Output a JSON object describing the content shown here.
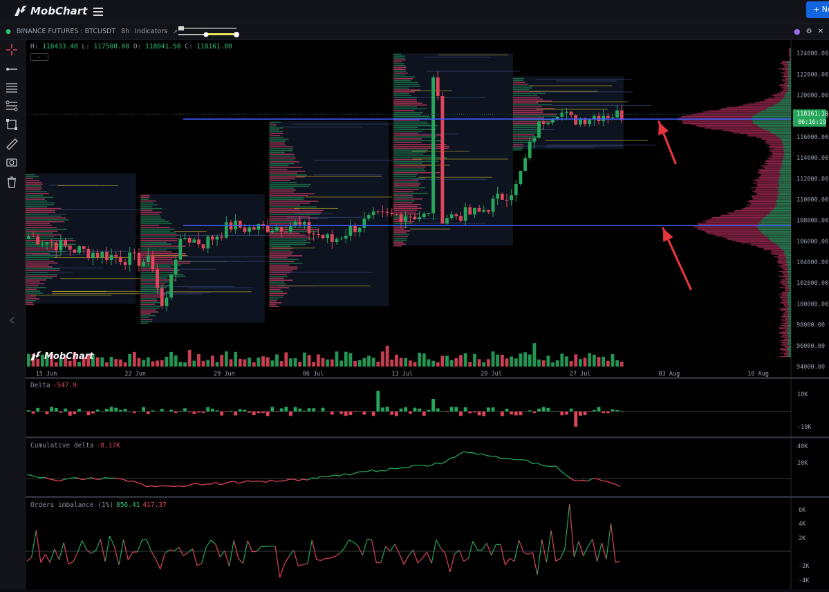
{
  "app": {
    "logo_text": "MobChart",
    "new_button_label": "+ Ne"
  },
  "symbol_bar": {
    "exchange_symbol": "BINANCE FUTURES : BTCUSDT",
    "timeframe": "8h",
    "indicators_label": "Indicators"
  },
  "ohlc": {
    "h_label": "H:",
    "h": "118433.40",
    "l_label": "L:",
    "l": "117500.00",
    "o_label": "O:",
    "o": "118041.50",
    "c_label": "C:",
    "c": "118161.00"
  },
  "watermark": "MobChart",
  "price_axis": {
    "labels": [
      "124000.00",
      "122000.00",
      "120000.00",
      "118000.00",
      "116000.00",
      "114000.00",
      "112000.00",
      "110000.00",
      "108000.00",
      "106000.00",
      "104000.00",
      "102000.00",
      "100000.00",
      "98000.00",
      "96000.00",
      "94000.00"
    ],
    "current_price": "118161.10",
    "countdown": "06:16:19"
  },
  "time_axis": {
    "labels": [
      "15 Jun",
      "22 Jun",
      "29 Jun",
      "06 Jul",
      "13 Jul",
      "20 Jul",
      "27 Jul",
      "03 Aug",
      "10 Aug"
    ]
  },
  "panels": {
    "delta": {
      "label": "Delta",
      "value": "-547.9",
      "axis": [
        "10K",
        "-10K"
      ]
    },
    "cumulative_delta": {
      "label": "Cumulative delta",
      "value": "-8.17K",
      "axis": [
        "40K",
        "20K"
      ]
    },
    "orders_imbalance": {
      "label": "Orders imbalance (1%)",
      "value_pos": "856.41",
      "value_neg": "417.37",
      "axis": [
        "6K",
        "4K",
        "2K",
        "-2K",
        "-4K"
      ]
    }
  },
  "chart_data": {
    "type": "candlestick",
    "symbol": "BTCUSDT",
    "interval": "8h",
    "ylim": [
      94000,
      125000
    ],
    "horizontal_lines": [
      117700,
      107500
    ],
    "current_price": 118161.1,
    "colors": {
      "up": "#26a65b",
      "down": "#e0455a",
      "line": "#3d5afe",
      "price_tag": "#26a65b"
    }
  }
}
